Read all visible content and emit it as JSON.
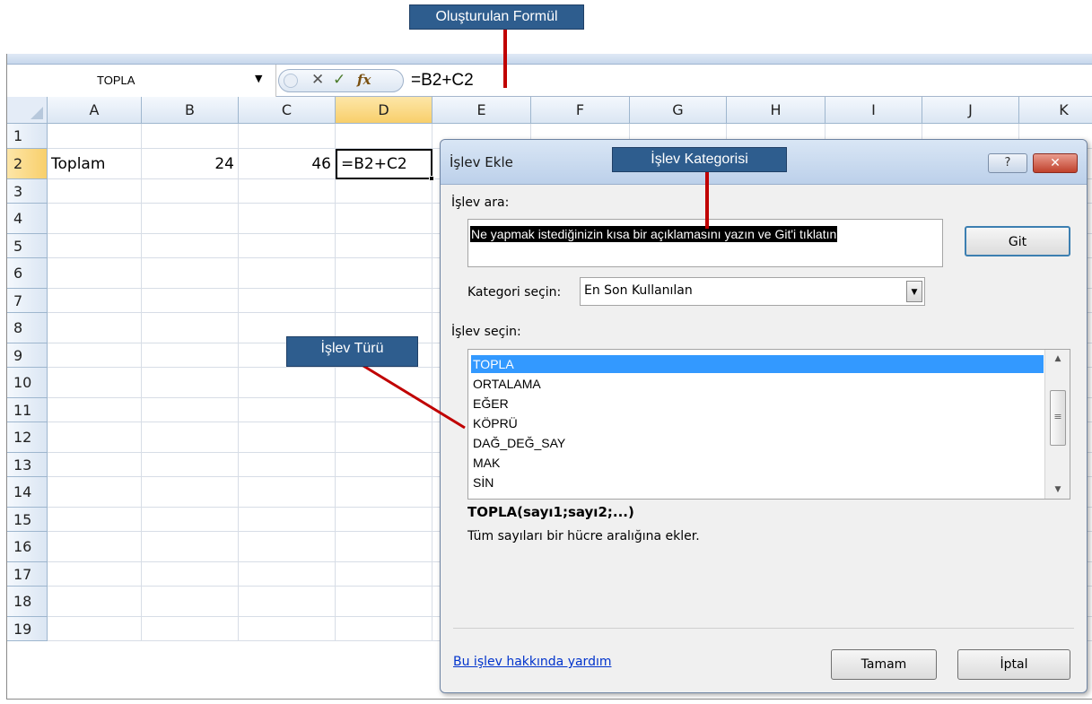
{
  "callouts": {
    "formula": "Oluşturulan Formül",
    "category": "İşlev Kategorisi",
    "type": "İşlev Türü"
  },
  "formula_bar": {
    "name_box": "TOPLA",
    "formula": "=B2+C2"
  },
  "columns": [
    "A",
    "B",
    "C",
    "D",
    "E",
    "F",
    "G",
    "H",
    "I",
    "J",
    "K"
  ],
  "rows": [
    "1",
    "2",
    "3",
    "4",
    "5",
    "6",
    "7",
    "8",
    "9",
    "10",
    "11",
    "12",
    "13",
    "14",
    "15",
    "16",
    "17",
    "18",
    "19"
  ],
  "cells": {
    "A2": "Toplam",
    "B2": "24",
    "C2": "46",
    "D2": "=B2+C2"
  },
  "dialog": {
    "title": "İşlev Ekle",
    "help_glyph": "?",
    "close_glyph": "✕",
    "search_label": "İşlev ara:",
    "search_value": "Ne yapmak istediğinizin kısa bir açıklamasını yazın ve Git'i tıklatın",
    "go_button": "Git",
    "category_label": "Kategori seçin:",
    "category_value": "En Son Kullanılan",
    "select_label": "İşlev seçin:",
    "functions": [
      "TOPLA",
      "ORTALAMA",
      "EĞER",
      "KÖPRÜ",
      "DAĞ_DEĞ_SAY",
      "MAK",
      "SİN"
    ],
    "selected_function": "TOPLA",
    "signature": "TOPLA(sayı1;sayı2;...)",
    "description": "Tüm sayıları bir hücre aralığına ekler.",
    "help_link": "Bu işlev hakkında yardım",
    "ok_button": "Tamam",
    "cancel_button": "İptal"
  },
  "colors": {
    "callout_bg": "#2e5d8e",
    "callout_line": "#c00000",
    "selection": "#3399ff"
  }
}
